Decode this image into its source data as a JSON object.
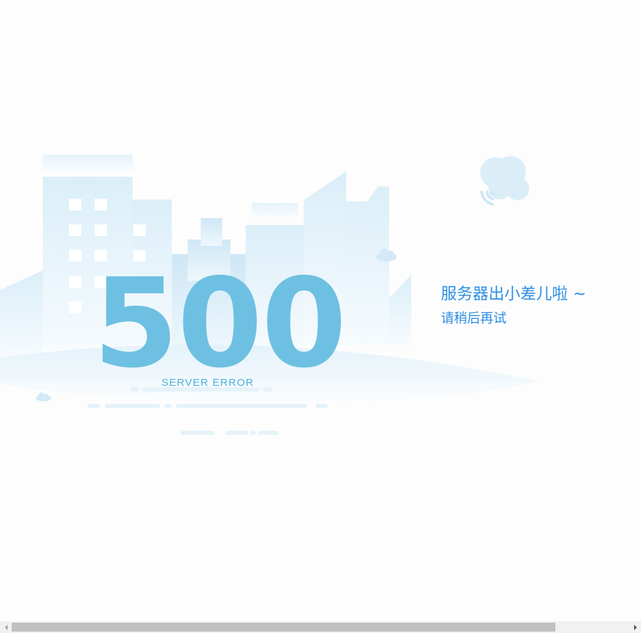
{
  "error": {
    "code": "500",
    "label": "SERVER ERROR",
    "title": "服务器出小差儿啦 ~",
    "subtitle": "请稍后再试"
  },
  "colors": {
    "code": "#6ec0e2",
    "message": "#2d8ee3",
    "building": "#e3f1f9",
    "scrollbar_thumb": "#c1c1c1",
    "scrollbar_track": "#f1f1f1"
  },
  "icons": {
    "cloud_signal": "cloud-signal-icon",
    "small_cloud": "cloud-icon",
    "scroll_left": "arrow-left-icon",
    "scroll_right": "arrow-right-icon"
  }
}
